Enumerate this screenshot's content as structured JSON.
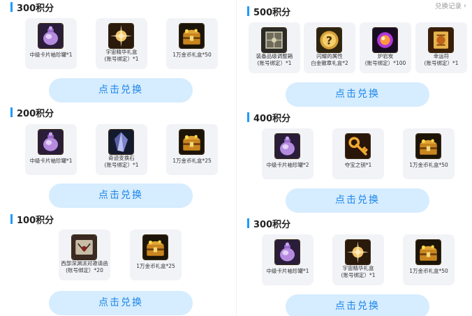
{
  "header": {
    "record_label": "兑换记录"
  },
  "left": {
    "sections": [
      {
        "title": "300积分",
        "items": [
          {
            "line1": "中级卡片袖珍罐*1",
            "line2": "",
            "icon": "purple-pot-icon"
          },
          {
            "line1": "宇宙精华礼盒",
            "line2": "(账号绑定）*1",
            "icon": "cosmic-essence-icon"
          },
          {
            "line1": "1万金币礼盒*50",
            "line2": "",
            "icon": "gold-chest-icon"
          }
        ],
        "button": "点击兑换"
      },
      {
        "title": "200积分",
        "items": [
          {
            "line1": "中级卡片袖珍罐*1",
            "line2": "",
            "icon": "purple-pot-icon"
          },
          {
            "line1": "奇迹变换石",
            "line2": "(账号绑定）*1",
            "icon": "miracle-stone-icon"
          },
          {
            "line1": "1万金币礼盒*25",
            "line2": "",
            "icon": "gold-chest-icon"
          }
        ],
        "button": "点击兑换"
      },
      {
        "title": "100积分",
        "items": [
          {
            "line1": "西部深渊派对邀请函",
            "line2": "(账号绑定）*20",
            "icon": "abyss-invitation-icon"
          },
          {
            "line1": "1万金币礼盒*25",
            "line2": "",
            "icon": "gold-chest-icon"
          }
        ],
        "button": "点击兑换"
      }
    ]
  },
  "right": {
    "sections": [
      {
        "title": "500积分",
        "items": [
          {
            "line1": "装备品级调整箱",
            "line2": "(账号绑定）*1",
            "icon": "grade-box-icon"
          },
          {
            "line1": "闪耀的属性",
            "line2": "白金徽章礼盒*2",
            "icon": "mystery-badge-icon"
          },
          {
            "line1": "炉岩炭",
            "line2": "(账号绑定）*100",
            "icon": "magma-orb-icon"
          },
          {
            "line1": "幸运符",
            "line2": "(账号绑定）*1",
            "icon": "lucky-charm-icon"
          }
        ],
        "button": "点击兑换"
      },
      {
        "title": "400积分",
        "items": [
          {
            "line1": "中级卡片袖珍罐*2",
            "line2": "",
            "icon": "purple-pot-icon"
          },
          {
            "line1": "夺宝之钥*1",
            "line2": "",
            "icon": "treasure-key-icon"
          },
          {
            "line1": "1万金币礼盒*50",
            "line2": "",
            "icon": "gold-chest-icon"
          }
        ],
        "button": "点击兑换"
      },
      {
        "title": "300积分",
        "items": [
          {
            "line1": "中级卡片袖珍罐*1",
            "line2": "",
            "icon": "purple-pot-icon"
          },
          {
            "line1": "宇宙精华礼盒",
            "line2": "(账号绑定）*1",
            "icon": "cosmic-essence-icon"
          },
          {
            "line1": "1万金币礼盒*50",
            "line2": "",
            "icon": "gold-chest-icon"
          }
        ],
        "button": "点击兑换"
      }
    ]
  }
}
